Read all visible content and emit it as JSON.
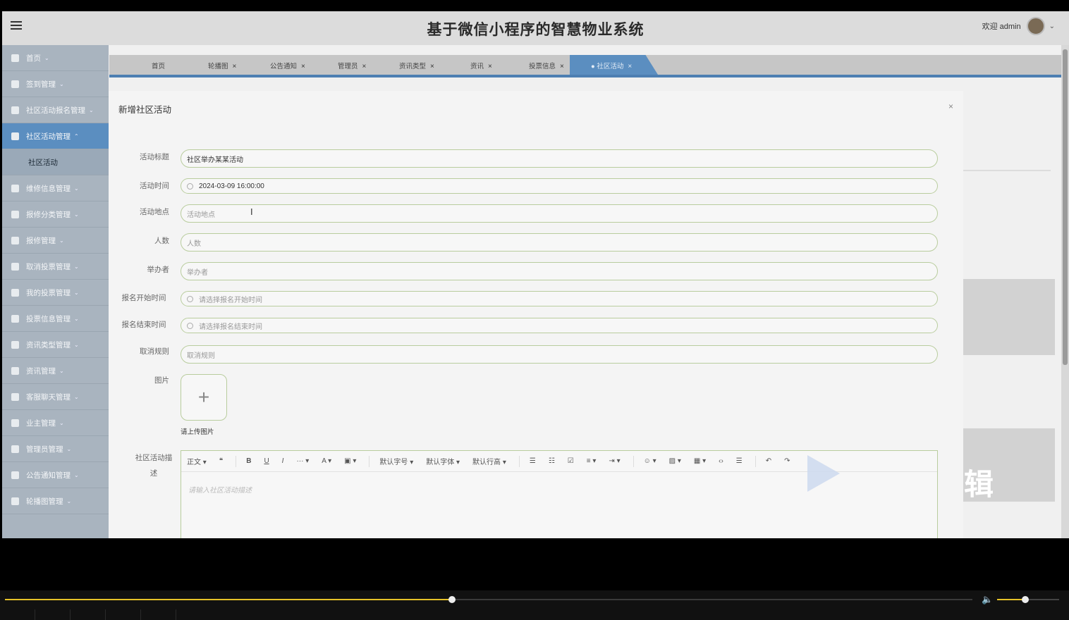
{
  "app": {
    "title": "基于微信小程序的智慧物业系统",
    "user_greeting": "欢迎 admin"
  },
  "sidebar": {
    "items": [
      {
        "label": "首页"
      },
      {
        "label": "签到管理"
      },
      {
        "label": "社区活动报名管理"
      },
      {
        "label": "社区活动管理",
        "active": true
      },
      {
        "label": "维修信息管理"
      },
      {
        "label": "报修分类管理"
      },
      {
        "label": "报修管理"
      },
      {
        "label": "取消投票管理"
      },
      {
        "label": "我的投票管理"
      },
      {
        "label": "投票信息管理"
      },
      {
        "label": "资讯类型管理"
      },
      {
        "label": "资讯管理"
      },
      {
        "label": "客服聊天管理"
      },
      {
        "label": "业主管理"
      },
      {
        "label": "管理员管理"
      },
      {
        "label": "公告通知管理"
      },
      {
        "label": "轮播图管理"
      }
    ],
    "sub_item": "社区活动"
  },
  "tabs": [
    {
      "label": "首页"
    },
    {
      "label": "轮播图"
    },
    {
      "label": "公告通知"
    },
    {
      "label": "管理员"
    },
    {
      "label": "资讯类型"
    },
    {
      "label": "资讯"
    },
    {
      "label": "投票信息"
    },
    {
      "label": "● 社区活动",
      "active": true
    }
  ],
  "tab_close": "×",
  "modal": {
    "title": "新增社区活动",
    "close": "×",
    "fields": {
      "title_label": "活动标题",
      "title_value": "社区举办某某活动",
      "time_label": "活动时间",
      "time_value": "2024-03-09 16:00:00",
      "place_label": "活动地点",
      "place_placeholder": "活动地点",
      "count_label": "人数",
      "count_placeholder": "人数",
      "organizer_label": "举办者",
      "organizer_placeholder": "举办者",
      "signup_start_label": "报名开始时间",
      "signup_start_placeholder": "请选择报名开始时间",
      "signup_end_label": "报名结束时间",
      "signup_end_placeholder": "请选择报名结束时间",
      "cancel_rule_label": "取消规则",
      "cancel_rule_placeholder": "取消规则",
      "image_label": "图片",
      "upload_tip": "请上传图片",
      "desc_label": "社区活动描述",
      "desc_placeholder": "请输入社区活动描述"
    },
    "toolbar": [
      "正文 ▾",
      "❝",
      "B",
      "U",
      "I",
      "··· ▾",
      "A ▾",
      "▣ ▾",
      "默认字号 ▾",
      "默认字体 ▾",
      "默认行高 ▾",
      "☰",
      "☷",
      "☑",
      "≡ ▾",
      "⇥ ▾",
      "☺ ▾",
      "▨ ▾",
      "▦ ▾",
      "‹›",
      "☰",
      "↶",
      "↷"
    ]
  },
  "watermark": {
    "text": "辑"
  },
  "player": {
    "progress": 0.462,
    "volume": 0.45
  }
}
